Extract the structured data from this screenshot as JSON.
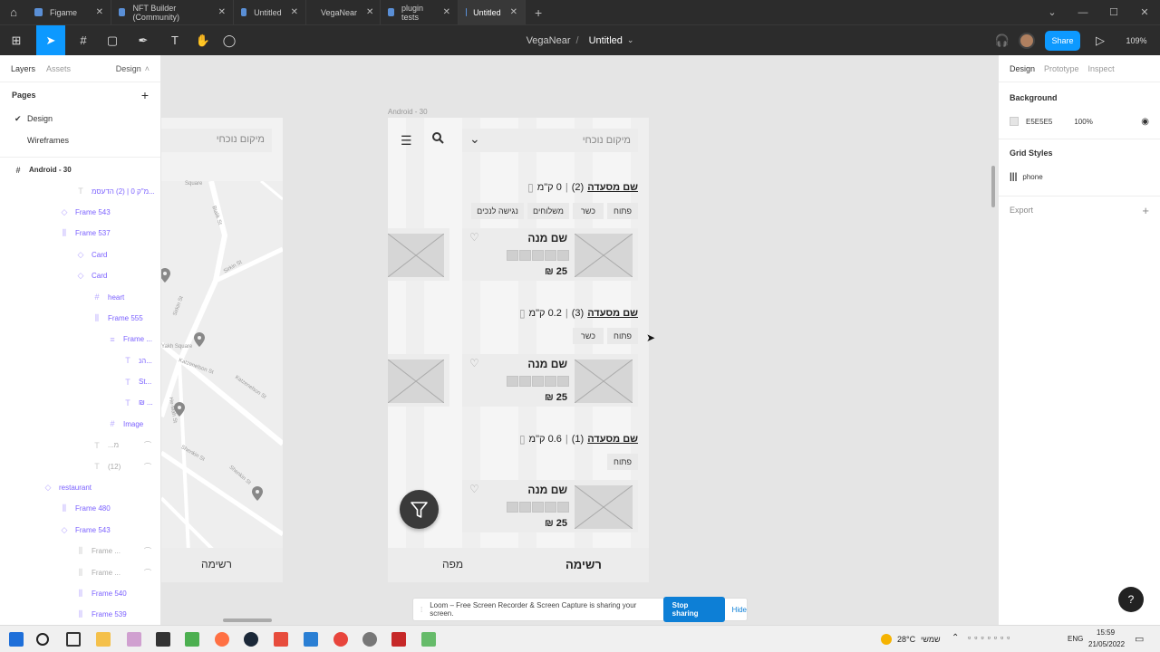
{
  "tabs": [
    {
      "label": "Figame",
      "active": false
    },
    {
      "label": "NFT Builder (Community)",
      "active": false
    },
    {
      "label": "Untitled",
      "active": false
    },
    {
      "label": "VegaNear",
      "active": false
    },
    {
      "label": "plugin tests",
      "active": false
    },
    {
      "label": "Untitled",
      "active": true
    }
  ],
  "toolbar": {
    "project": "VegaNear",
    "separator": "/",
    "file": "Untitled",
    "share_label": "Share",
    "zoom": "109%"
  },
  "left_panel": {
    "tab_layers": "Layers",
    "tab_assets": "Assets",
    "page_switcher": "Design",
    "pages_title": "Pages",
    "pages": [
      "Design",
      "Wireframes"
    ],
    "layers": [
      {
        "label": "Android - 30",
        "icon": "#"
      },
      {
        "label": "מ\"ק 0 | (2) הדעסמ...",
        "icon": "T"
      },
      {
        "label": "Frame 543",
        "icon": "◇"
      },
      {
        "label": "Frame 537",
        "icon": "⫼"
      },
      {
        "label": "Card",
        "icon": "◇"
      },
      {
        "label": "Card",
        "icon": "◇"
      },
      {
        "label": "heart",
        "icon": "#"
      },
      {
        "label": "Frame 555",
        "icon": "⫼"
      },
      {
        "label": "Frame ...",
        "icon": "≡"
      },
      {
        "label": "הנ...",
        "icon": "T"
      },
      {
        "label": "St...",
        "icon": "T"
      },
      {
        "label": "₪ ...",
        "icon": "T"
      },
      {
        "label": "Image",
        "icon": "#"
      },
      {
        "label": "...מ",
        "icon": "T"
      },
      {
        "label": "(12)",
        "icon": "T"
      },
      {
        "label": "restaurant",
        "icon": "◇"
      },
      {
        "label": "Frame 480",
        "icon": "⫼"
      },
      {
        "label": "Frame 543",
        "icon": "◇"
      },
      {
        "label": "Frame ...",
        "icon": "⫼"
      },
      {
        "label": "Frame ...",
        "icon": "⫼"
      },
      {
        "label": "Frame 540",
        "icon": "⫼"
      },
      {
        "label": "Frame 539",
        "icon": "⫼"
      }
    ]
  },
  "canvas": {
    "frame_label": "Android - 30",
    "search_placeholder": "מיקום נוכחי",
    "restaurants": [
      {
        "name": "שם מסעדה",
        "count": "(2)",
        "distance": "0 ק\"מ",
        "tags": [
          "פתוח",
          "כשר",
          "משלוחים",
          "נגישה לנכים"
        ]
      },
      {
        "name": "שם מסעדה",
        "count": "(3)",
        "distance": "0.2 ק\"מ",
        "tags": [
          "פתוח",
          "כשר"
        ]
      },
      {
        "name": "שם מסעדה",
        "count": "(1)",
        "distance": "0.6 ק\"מ",
        "tags": [
          "פתוח"
        ]
      }
    ],
    "dish_name": "שם מנה",
    "dish_price": "25 ₪",
    "bottom_list": "רשימה",
    "bottom_map": "מפה",
    "map_streets": [
      "Bialik St",
      "Sirkin St",
      "Sirkin St",
      "Katzenelson St",
      "Katzenelson St",
      "Shenkin St",
      "Shenkin St",
      "He-Mah St",
      "Square",
      "Yakh Square"
    ]
  },
  "right_panel": {
    "tabs": [
      "Design",
      "Prototype",
      "Inspect"
    ],
    "background_title": "Background",
    "background_hex": "E5E5E5",
    "background_opacity": "100%",
    "grid_title": "Grid Styles",
    "grid_name": "phone",
    "export_title": "Export"
  },
  "loom": {
    "message": "Loom – Free Screen Recorder & Screen Capture is sharing your screen.",
    "stop": "Stop sharing",
    "hide": "Hide"
  },
  "taskbar": {
    "weather": "28°C",
    "weather_label": "שמשי",
    "lang": "ENG",
    "time": "15:59",
    "date": "21/05/2022"
  }
}
